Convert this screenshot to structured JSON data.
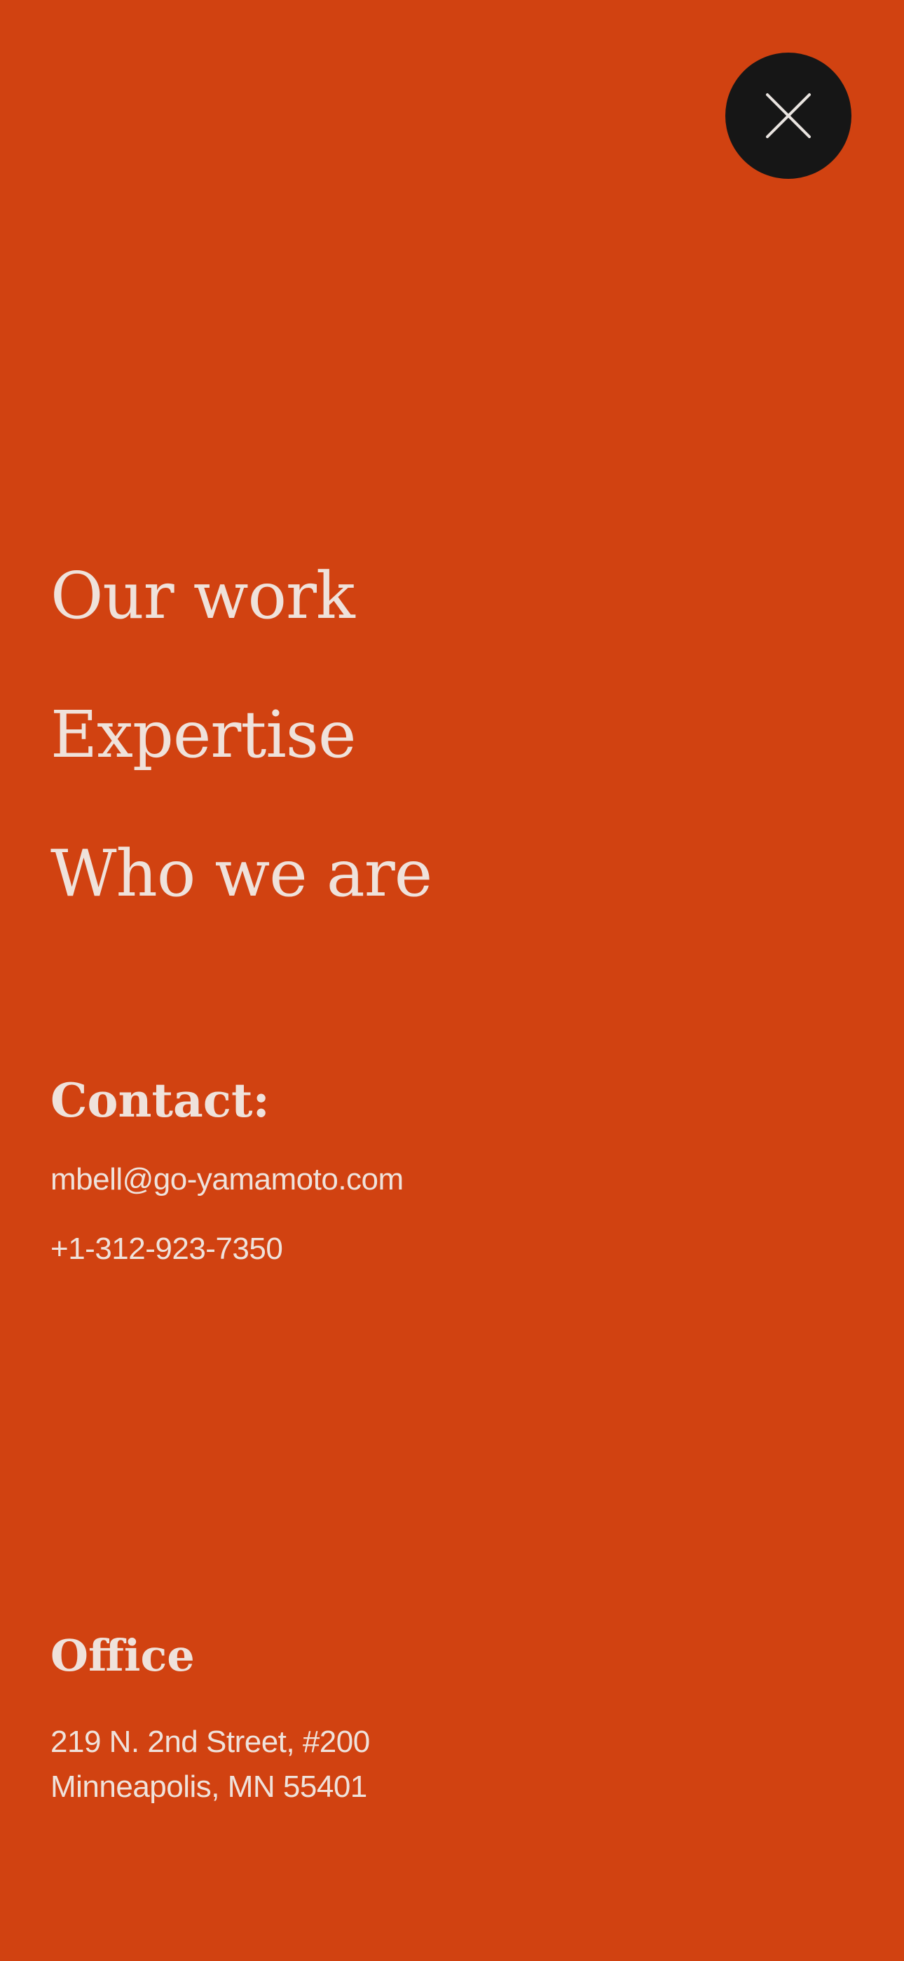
{
  "colors": {
    "background": "#d14211",
    "text": "#efe2db",
    "close_button_bg": "#161616"
  },
  "close_button": {
    "icon": "close-icon"
  },
  "nav": {
    "items": [
      {
        "label": "Our work"
      },
      {
        "label": "Expertise"
      },
      {
        "label": "Who we are"
      }
    ]
  },
  "contact": {
    "heading": "Contact:",
    "email": "mbell@go-yamamoto.com",
    "phone": "+1-312-923-7350"
  },
  "office": {
    "heading": "Office",
    "address_line1": "219 N. 2nd Street, #200",
    "address_line2": "Minneapolis, MN 55401"
  }
}
